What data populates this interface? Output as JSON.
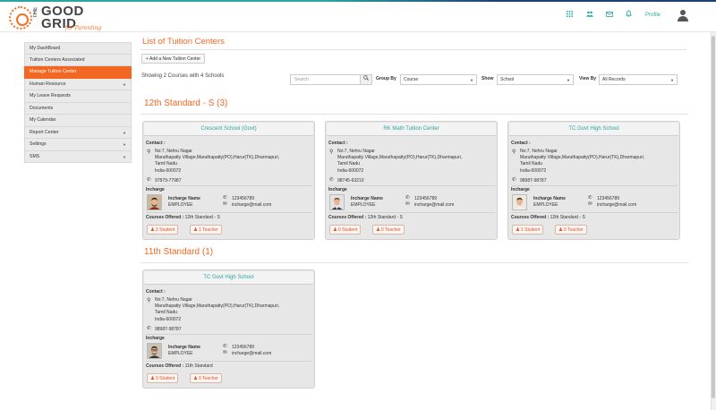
{
  "brand": {
    "line1": "THE",
    "line2": "GOOD",
    "line3": "GRID",
    "tagline": "for Parenting"
  },
  "topbar": {
    "profile_label": "Profile",
    "icons": [
      "grid-icon",
      "users-icon",
      "mail-icon",
      "bell-icon"
    ]
  },
  "sidebar": {
    "items": [
      {
        "label": "My DashBoard",
        "has_caret": false
      },
      {
        "label": "Tuition Centers Associated",
        "has_caret": false
      },
      {
        "label": "Manage Tuition Center",
        "has_caret": false,
        "active": true
      },
      {
        "label": "Human Resource",
        "has_caret": true
      },
      {
        "label": "My Leave Requests",
        "has_caret": false
      },
      {
        "label": "Documents",
        "has_caret": false
      },
      {
        "label": "My Calendar",
        "has_caret": false
      },
      {
        "label": "Report Center",
        "has_caret": true
      },
      {
        "label": "Settings",
        "has_caret": true
      },
      {
        "label": "SMS",
        "has_caret": true
      }
    ]
  },
  "main": {
    "title": "List of Tuition Centers",
    "add_button": "+ Add a New Tuition Center",
    "showing": "Showing 2 Courses with 4 Schools",
    "search_placeholder": "Search",
    "filters": {
      "group_by_label": "Group By",
      "group_by_value": "Course",
      "show_label": "Show",
      "show_value": "School",
      "view_by_label": "View By",
      "view_by_value": "All Records"
    }
  },
  "sections": [
    {
      "title": "12th Standard - S (3)",
      "cards": [
        {
          "name": "Crescent School (Govt)",
          "contact_label": "Contact :",
          "address": [
            "No:7, Nehru Nagar",
            "Maruthapatty Village,Maruthapatty(PO),Harur(TK),Dharmapuri,",
            "Tamil Nadu",
            "India-600072"
          ],
          "phone": "97879-77987",
          "incharge_label": "Incharge",
          "incharge_name_label": "Incharge Name",
          "incharge_name": "EMPLOYEE",
          "incharge_phone": "123456789",
          "incharge_email": "incharge@mail.com",
          "courses_label": "Courses Offered :",
          "courses": "12th Standard - S",
          "students": "2  Student",
          "teachers": "1 Teacher",
          "avatar": "man-beard"
        },
        {
          "name": "RK Math Tuition Center",
          "contact_label": "Contact :",
          "address": [
            "No:7, Nehru Nagar",
            "Maruthapatty Village,Maruthapatty(PO),Harur(TK),Dharmapuri,",
            "Tamil Nadu",
            "India-600072"
          ],
          "phone": "98745-63210",
          "incharge_label": "Incharge",
          "incharge_name_label": "Incharge Name",
          "incharge_name": "EMPLOYEE",
          "incharge_phone": "123456789",
          "incharge_email": "incharge@mail.com",
          "courses_label": "Courses Offered :",
          "courses": "12th Standard - S",
          "students": "0  Student",
          "teachers": "0 Teacher",
          "avatar": "man-suit"
        },
        {
          "name": "TC Govt High School",
          "contact_label": "Contact :",
          "address": [
            "No:7, Nehru Nagar",
            "Maruthapatty Village,Maruthapatty(PO),Harur(TK),Dharmapuri,",
            "Tamil Nadu",
            "India-600072"
          ],
          "phone": "98987-98787",
          "incharge_label": "Incharge",
          "incharge_name_label": "Incharge Name",
          "incharge_name": "EMPLOYEE",
          "incharge_phone": "123456789",
          "incharge_email": "incharge@mail.com",
          "courses_label": "Courses Offered :",
          "courses": "12th Standard - S",
          "students": "1  Student",
          "teachers": "0 Teacher",
          "avatar": "man-young"
        }
      ]
    },
    {
      "title": "11th Standard (1)",
      "cards": [
        {
          "name": "TC Govt High School",
          "contact_label": "Contact :",
          "address": [
            "No:7, Nehru Nagar",
            "Maruthapatty Village,Maruthapatty(PO),Harur(TK),Dharmapuri,",
            "Tamil Nadu",
            "India-600072"
          ],
          "phone": "98987-98787",
          "incharge_label": "Incharge",
          "incharge_name_label": "Incharge Name",
          "incharge_name": "EMPLOYEE",
          "incharge_phone": "123456789",
          "incharge_email": "incharge@mail.com",
          "courses_label": "Courses Offered :",
          "courses": "11th Standard",
          "students": "0  Student",
          "teachers": "0 Teacher",
          "avatar": "man-glasses"
        }
      ]
    }
  ],
  "colors": {
    "accent": "#f26722",
    "teal": "#2aa6a0",
    "card_bg": "#e7e7e7"
  }
}
